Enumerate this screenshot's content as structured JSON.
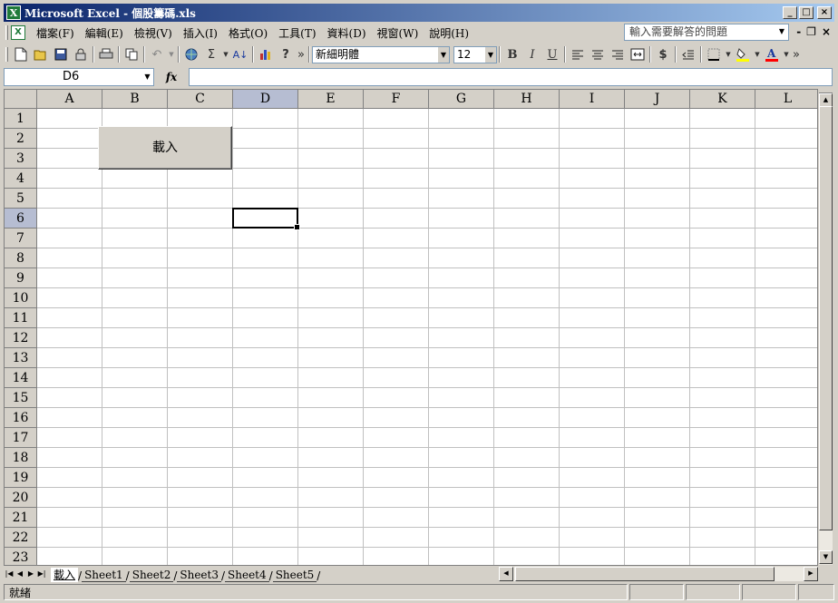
{
  "window": {
    "title": "Microsoft Excel - 個股籌碼.xls",
    "app_icon_glyph": "X",
    "min_glyph": "_",
    "max_glyph": "□",
    "close_glyph": "×"
  },
  "menubar": {
    "doc_glyph": "X",
    "items": [
      "檔案(F)",
      "編輯(E)",
      "檢視(V)",
      "插入(I)",
      "格式(O)",
      "工具(T)",
      "資料(D)",
      "視窗(W)",
      "說明(H)"
    ],
    "help_placeholder": "輸入需要解答的問題",
    "mdi_min": "-",
    "mdi_restore": "❐",
    "mdi_close": "×"
  },
  "toolbar": {
    "font_name": "新細明體",
    "font_size": "12",
    "bold": "B",
    "italic": "I",
    "underline": "U",
    "currency": "$",
    "autosum": "Σ",
    "more": "»"
  },
  "formulabar": {
    "name_box": "D6",
    "fx_label": "fx",
    "formula": ""
  },
  "grid": {
    "columns": [
      "A",
      "B",
      "C",
      "D",
      "E",
      "F",
      "G",
      "H",
      "I",
      "J",
      "K",
      "L"
    ],
    "rows": [
      "1",
      "2",
      "3",
      "4",
      "5",
      "6",
      "7",
      "8",
      "9",
      "10",
      "11",
      "12",
      "13",
      "14",
      "15",
      "16",
      "17",
      "18",
      "19",
      "20",
      "21",
      "22",
      "23"
    ],
    "selected_col": "D",
    "selected_row": "6",
    "selection_color": "#b6bdd2"
  },
  "load_button": {
    "label": "載入"
  },
  "sheet_tabs": {
    "tabs": [
      "載入",
      "Sheet1",
      "Sheet2",
      "Sheet3",
      "Sheet4",
      "Sheet5"
    ],
    "active": "載入"
  },
  "statusbar": {
    "text": "就緒"
  }
}
